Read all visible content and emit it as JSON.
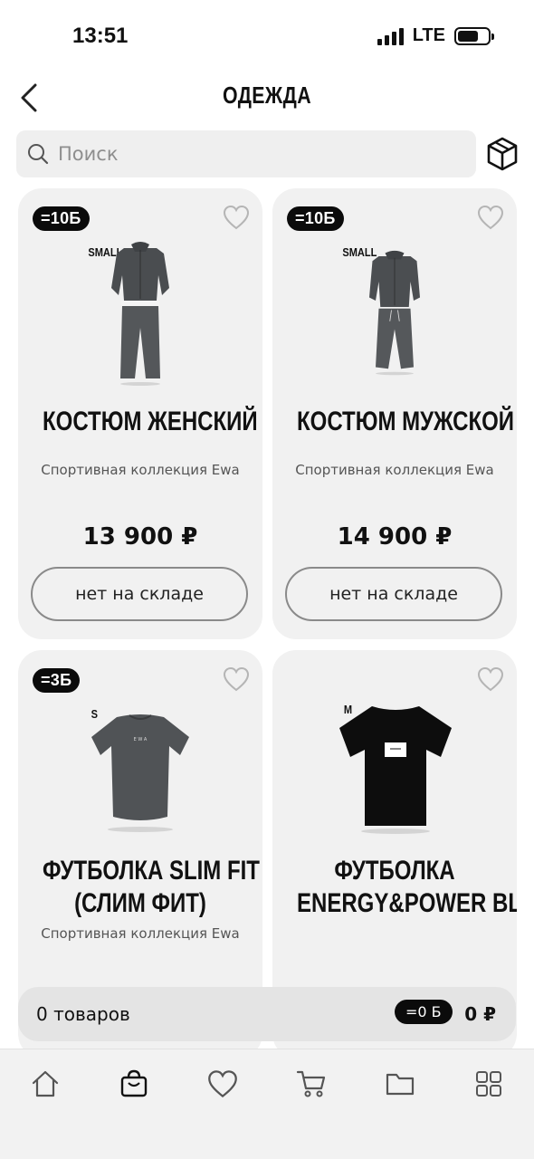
{
  "status_bar": {
    "time": "13:51",
    "network": "LTE"
  },
  "header": {
    "title": "ОДЕЖДА"
  },
  "search": {
    "placeholder": "Поиск"
  },
  "products": [
    {
      "badge": "=10Б",
      "size": "SMALL",
      "name": "КОСТЮМ ЖЕНСКИЙ",
      "description": "Спортивная коллекция Ewa",
      "price": "13 900 ₽",
      "button": "нет на складе"
    },
    {
      "badge": "=10Б",
      "size": "SMALL",
      "name": "КОСТЮМ МУЖСКОЙ",
      "description": "Спортивная коллекция Ewa",
      "price": "14 900 ₽",
      "button": "нет на складе"
    },
    {
      "badge": "=3Б",
      "size": "S",
      "name_line1": "ФУТБОЛКА SLIM FIT",
      "name_line2": "(СЛИМ ФИТ)",
      "description": "Спортивная коллекция Ewa"
    },
    {
      "size": "M",
      "name_line1": "ФУТБОЛКА",
      "name_line2": "ENERGY&POWER BL..."
    }
  ],
  "cart_bar": {
    "count_label": "0 товаров",
    "bonus": "=0 Б",
    "total": "0 ₽"
  },
  "bottom_nav": [
    "home-icon",
    "shopping-bag-icon",
    "heart-icon",
    "cart-icon",
    "folder-icon",
    "grid-icon"
  ],
  "colors": {
    "card_bg": "#f1f1f1",
    "badge_bg": "#0b0b0b",
    "accent": "#111111"
  }
}
